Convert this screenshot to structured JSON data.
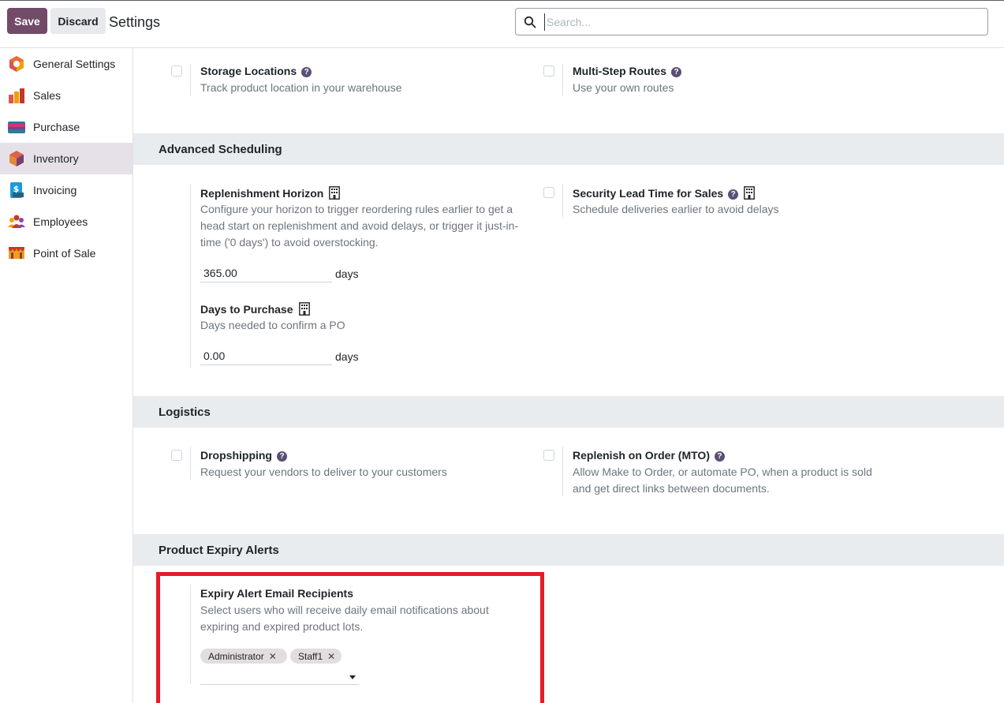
{
  "toolbar": {
    "save_label": "Save",
    "discard_label": "Discard",
    "title": "Settings"
  },
  "search": {
    "placeholder": "Search..."
  },
  "sidebar": {
    "items": [
      {
        "label": "General Settings",
        "icon": "general-settings-icon"
      },
      {
        "label": "Sales",
        "icon": "sales-icon"
      },
      {
        "label": "Purchase",
        "icon": "purchase-icon"
      },
      {
        "label": "Inventory",
        "icon": "inventory-icon",
        "active": true
      },
      {
        "label": "Invoicing",
        "icon": "invoicing-icon"
      },
      {
        "label": "Employees",
        "icon": "employees-icon"
      },
      {
        "label": "Point of Sale",
        "icon": "point-of-sale-icon"
      }
    ]
  },
  "warehouse": {
    "storage_locations": {
      "title": "Storage Locations",
      "desc": "Track product location in your warehouse",
      "checked": false
    },
    "multi_step_routes": {
      "title": "Multi-Step Routes",
      "desc": "Use your own routes",
      "checked": false
    }
  },
  "advanced_scheduling": {
    "title": "Advanced Scheduling",
    "replenishment_horizon": {
      "title": "Replenishment Horizon",
      "desc": "Configure your horizon to trigger reordering rules earlier to get a head start on replenishment and avoid delays, or trigger it just-in-time ('0 days') to avoid overstocking.",
      "value": "365.00",
      "unit": "days"
    },
    "days_to_purchase": {
      "title": "Days to Purchase",
      "desc": "Days needed to confirm a PO",
      "value": "0.00",
      "unit": "days"
    },
    "security_lead_time": {
      "title": "Security Lead Time for Sales",
      "desc": "Schedule deliveries earlier to avoid delays",
      "checked": false
    }
  },
  "logistics": {
    "title": "Logistics",
    "dropshipping": {
      "title": "Dropshipping",
      "desc": "Request your vendors to deliver to your customers",
      "checked": false
    },
    "mto": {
      "title": "Replenish on Order (MTO)",
      "desc": "Allow Make to Order, or automate PO, when a product is sold and get direct links between documents.",
      "checked": false
    }
  },
  "expiry": {
    "title": "Product Expiry Alerts",
    "recipients": {
      "title": "Expiry Alert Email Recipients",
      "desc": "Select users who will receive daily email notifications about expiring and expired product lots.",
      "tags": [
        "Administrator",
        "Staff1"
      ],
      "remove_glyph": "✕"
    }
  },
  "colors": {
    "primary": "#714b67",
    "annotation": "#e21d26",
    "section_bg": "#e9ecef",
    "active_nav": "#e6e1e8"
  }
}
